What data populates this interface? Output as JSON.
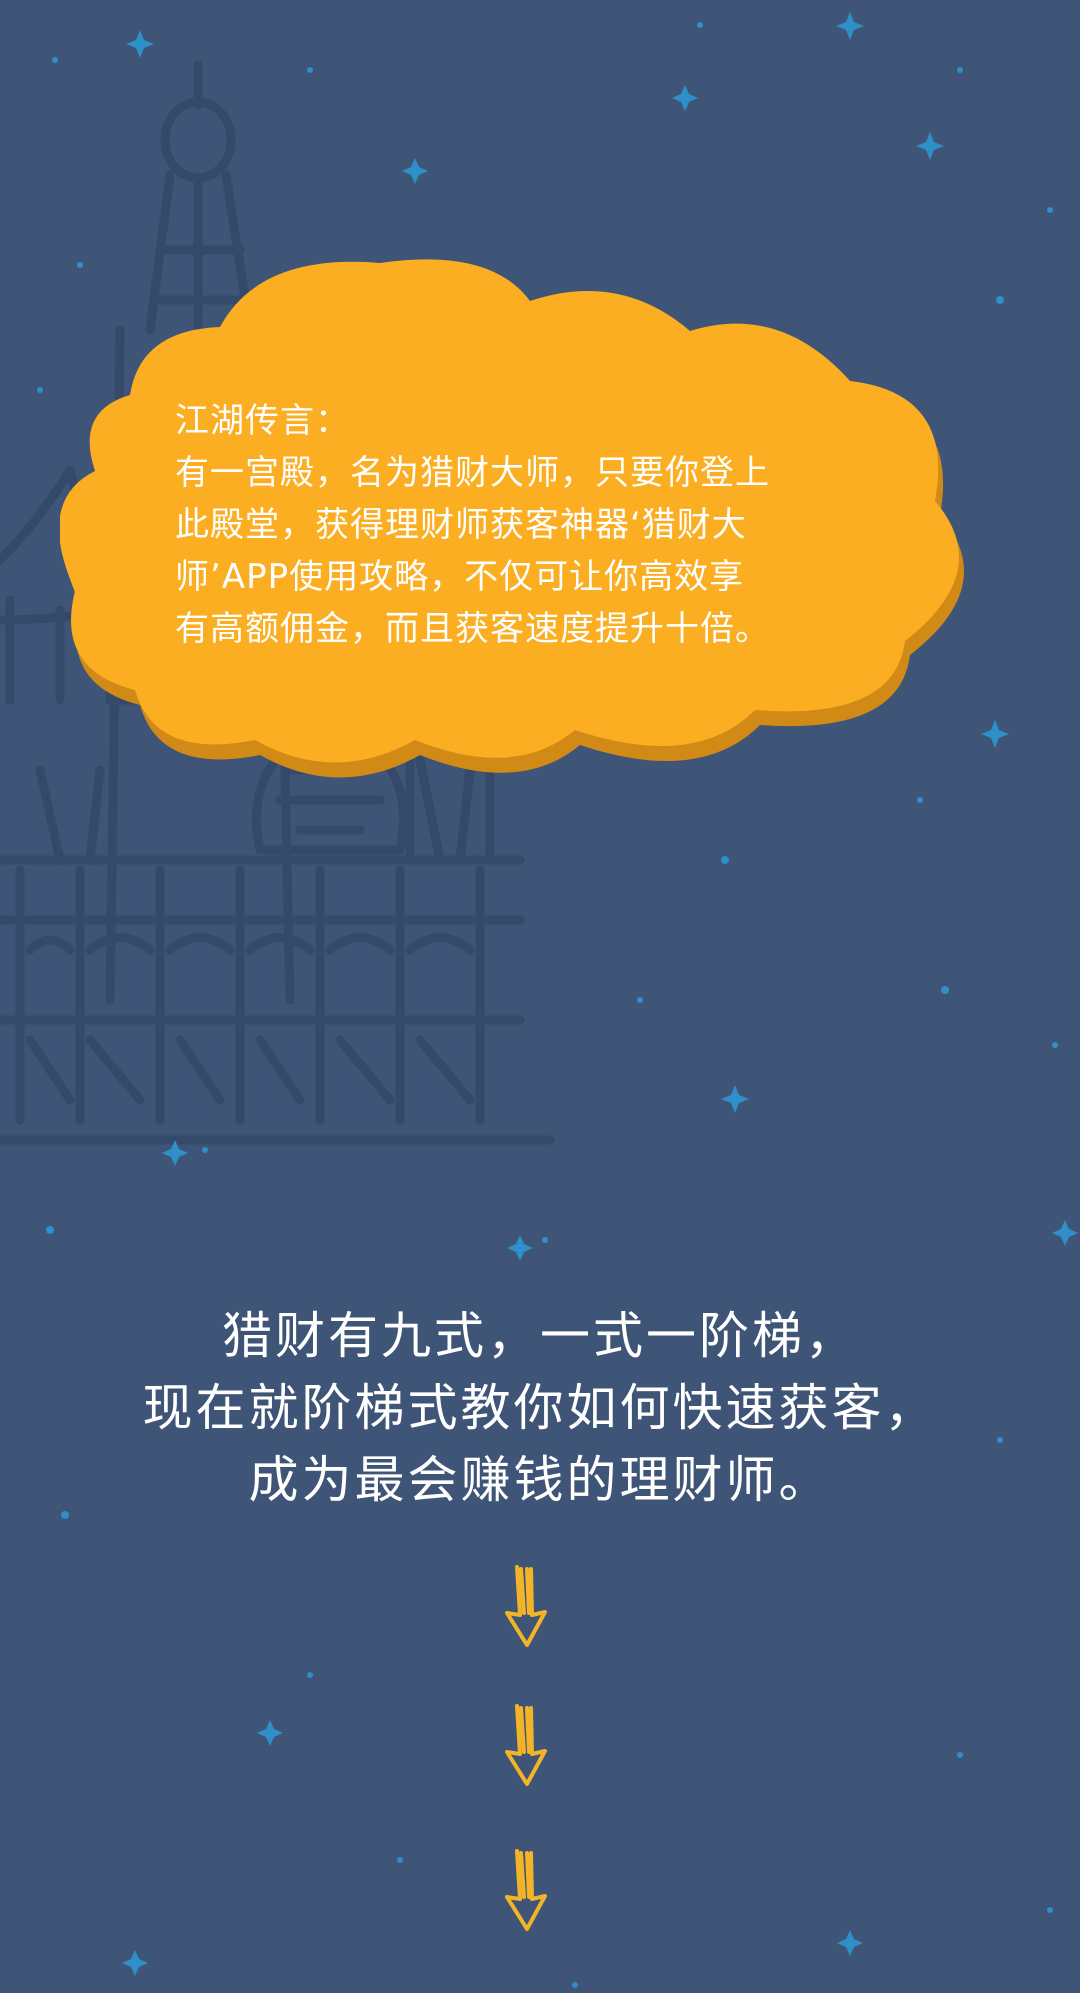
{
  "colors": {
    "background": "#3f5577",
    "cloud_fill": "#fbae22",
    "cloud_shadow": "#d08a15",
    "castle_sketch": "#354a6a",
    "star": "#2f8fc9",
    "arrow": "#f3b427",
    "text": "#ffffff"
  },
  "cloud": {
    "heading": "江湖传言：",
    "lines": [
      "有一宫殿，名为猎财大师，只要你登上",
      "此殿堂，获得理财师获客神器‘猎财大",
      "师’APP使用攻略，不仅可让你高效享",
      "有高额佣金，而且获客速度提升十倍。"
    ]
  },
  "main": {
    "lines": [
      "猎财有九式，一式一阶梯，",
      "现在就阶梯式教你如何快速获客，",
      "成为最会赚钱的理财师。"
    ]
  },
  "icons": {
    "arrow": "hand-drawn-down-arrow-icon",
    "star": "sparkle-star-icon",
    "castle": "castle-sketch-illustration"
  }
}
